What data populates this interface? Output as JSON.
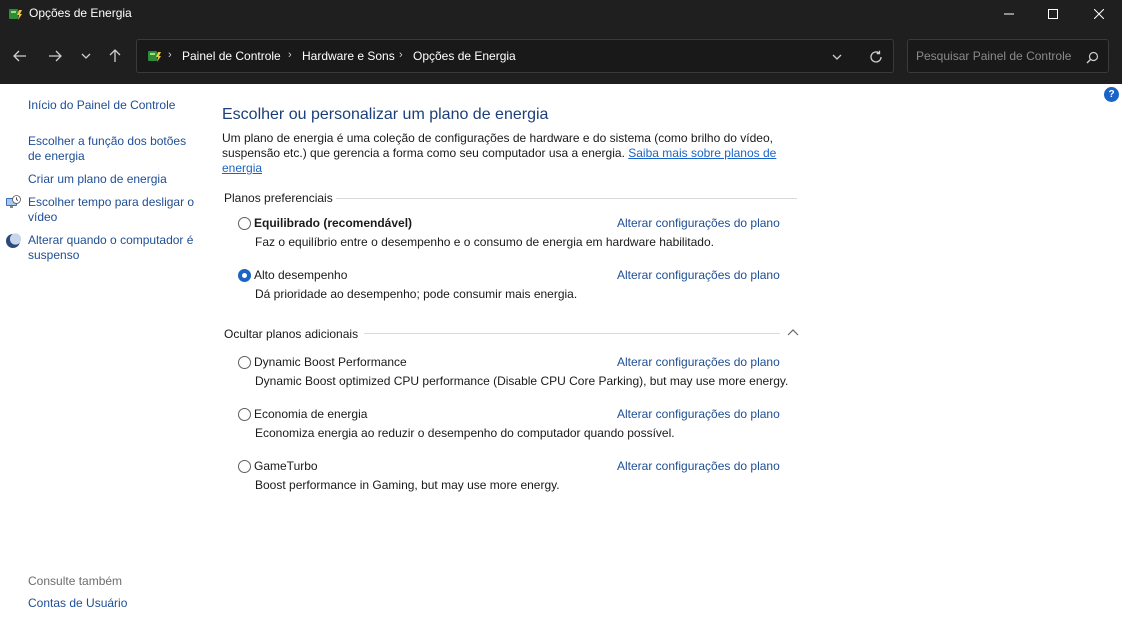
{
  "window": {
    "title": "Opções de Energia",
    "accent": "#1a64c8"
  },
  "nav": {
    "breadcrumb": [
      "Painel de Controle",
      "Hardware e Sons",
      "Opções de Energia"
    ],
    "search_placeholder": "Pesquisar Painel de Controle"
  },
  "sidebar": {
    "home": "Início do Painel de Controle",
    "items": [
      {
        "label": "Escolher a função dos botões de energia",
        "icon": ""
      },
      {
        "label": "Criar um plano de energia",
        "icon": ""
      },
      {
        "label": "Escolher tempo para desligar o vídeo",
        "icon": "monitor-clock-icon"
      },
      {
        "label": "Alterar quando o computador é suspenso",
        "icon": "moon-icon"
      }
    ],
    "see_also": "Consulte também",
    "see_also_items": [
      "Contas de Usuário"
    ]
  },
  "main": {
    "title": "Escolher ou personalizar um plano de energia",
    "description": "Um plano de energia é uma coleção de configurações de hardware e do sistema (como brilho do vídeo, suspensão etc.) que gerencia a forma como seu computador usa a energia.",
    "learn_more": "Saiba mais sobre planos de energia",
    "preferred_header": "Planos preferenciais",
    "additional_header": "Ocultar planos adicionais",
    "change_link": "Alterar configurações do plano",
    "preferred_plans": [
      {
        "name": "Equilibrado (recomendável)",
        "description": "Faz o equilíbrio entre o desempenho e o consumo de energia em hardware habilitado.",
        "selected": false
      },
      {
        "name": "Alto desempenho",
        "description": "Dá prioridade ao desempenho; pode consumir mais energia.",
        "selected": true
      }
    ],
    "additional_plans": [
      {
        "name": "Dynamic Boost Performance",
        "description": "Dynamic Boost optimized CPU performance (Disable CPU Core Parking), but may use more energy.",
        "selected": false
      },
      {
        "name": "Economia de energia",
        "description": "Economiza energia ao reduzir o desempenho do computador quando possível.",
        "selected": false
      },
      {
        "name": "GameTurbo",
        "description": "Boost performance in Gaming, but may use more energy.",
        "selected": false
      }
    ]
  }
}
